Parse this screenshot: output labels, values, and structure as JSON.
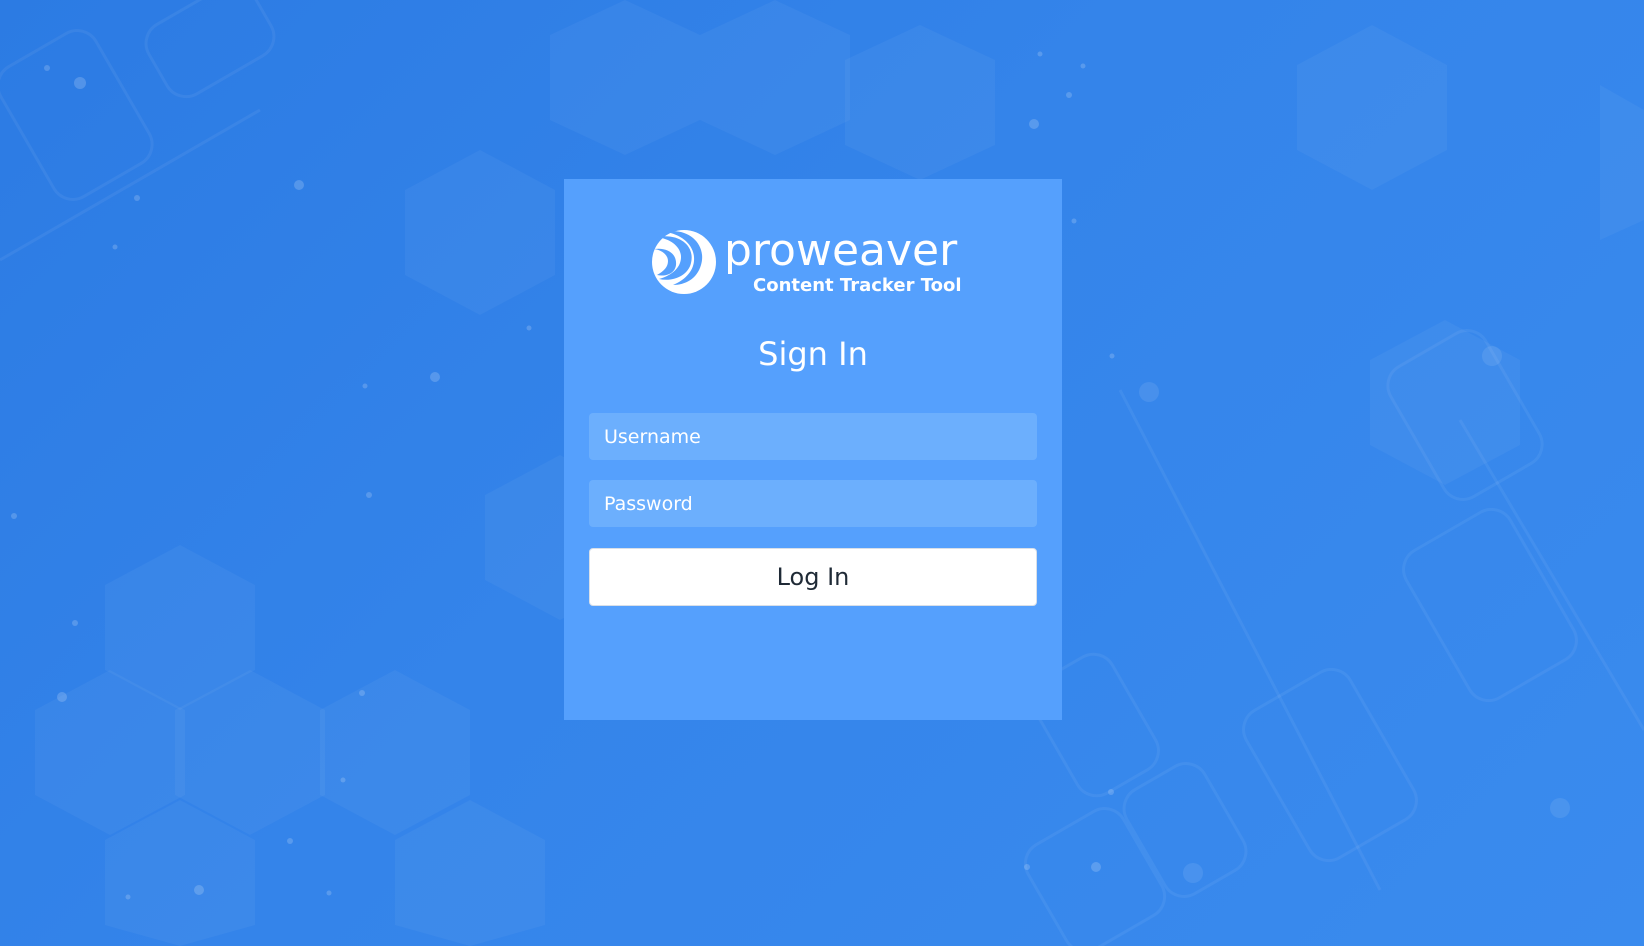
{
  "colors": {
    "background": "#2f80e7",
    "card": "#55a0fd",
    "input": "#6caffd",
    "button": "#ffffff",
    "text": "#ffffff"
  },
  "brand": {
    "name": "proweaver",
    "subtitle": "Content Tracker Tool",
    "icon": "proweaver-logo-icon"
  },
  "form": {
    "title": "Sign In",
    "username_placeholder": "Username",
    "password_placeholder": "Password",
    "submit_label": "Log In"
  }
}
